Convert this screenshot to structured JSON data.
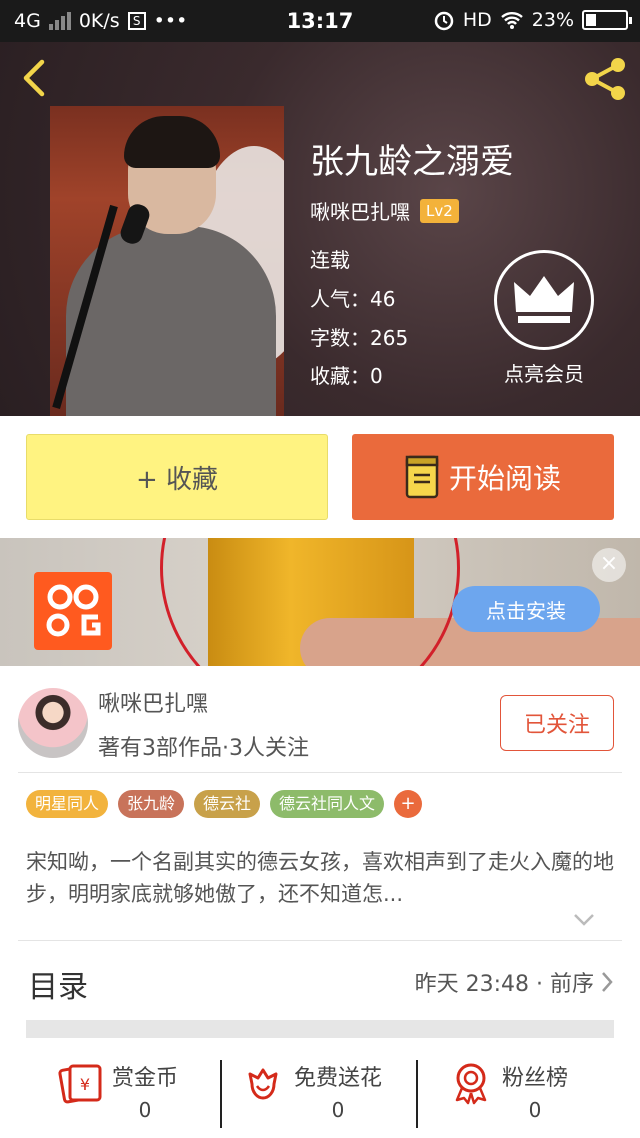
{
  "statusbar": {
    "network": "4G",
    "speed": "0K/s",
    "s_badge": "S",
    "dots": "•••",
    "time": "13:17",
    "hd": "HD",
    "battery": "23%"
  },
  "book": {
    "title": "张九龄之溺爱",
    "author": "啾咪巴扎嘿",
    "level": "Lv2",
    "status": "连载",
    "popularity": "人气：46",
    "words": "字数：265",
    "favorites": "收藏：0",
    "vip_label": "点亮会员"
  },
  "actions": {
    "favorite": "+ 收藏",
    "read": "开始阅读"
  },
  "ad": {
    "install": "点击安装",
    "close": "×"
  },
  "author": {
    "name": "啾咪巴扎嘿",
    "summary": "著有3部作品·3人关注",
    "follow": "已关注"
  },
  "tags": [
    {
      "label": "明星同人",
      "color": "#f2b33d"
    },
    {
      "label": "张九龄",
      "color": "#c8735a"
    },
    {
      "label": "德云社",
      "color": "#c8a14a"
    },
    {
      "label": "德云社同人文",
      "color": "#8dbb6a"
    }
  ],
  "tag_add": "+",
  "description": "宋知呦，一个名副其实的德云女孩，喜欢相声到了走火入魔的地步，明明家底就够她傲了，还不知道怎...",
  "toc": {
    "title": "目录",
    "latest": "昨天 23:48 · 前序"
  },
  "bottom": {
    "reward_label": "赏金币",
    "reward_count": "0",
    "flower_label": "免费送花",
    "flower_count": "0",
    "fans_label": "粉丝榜",
    "fans_count": "0"
  },
  "colors": {
    "accent": "#ea6a3c",
    "favorite_bg": "#fff381",
    "follow_red": "#e2553a"
  }
}
